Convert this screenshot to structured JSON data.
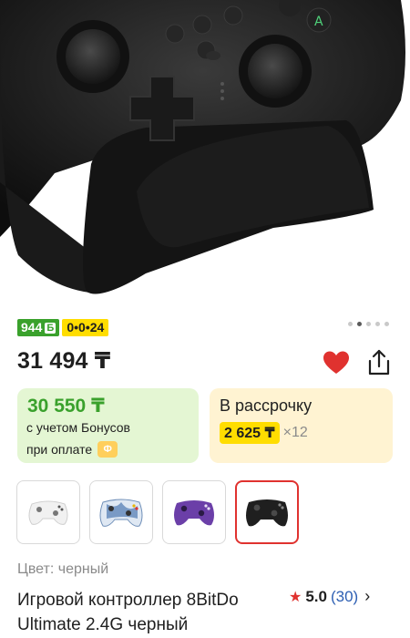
{
  "bonus_badge": {
    "value": "944",
    "icon_letter": "Б"
  },
  "installment_badge": {
    "text": "0•0•24"
  },
  "gallery": {
    "total": 5,
    "active_index": 2
  },
  "price": {
    "current": "31 494 ₸"
  },
  "actions": {
    "favorite_icon": "heart-icon",
    "share_icon": "share-icon",
    "favorite_color": "#e0322f"
  },
  "bonus_card": {
    "amount": "30 550 ₸",
    "line1": "с учетом Бонусов",
    "line2": "при оплате",
    "pay_icon_letter": "Ф"
  },
  "installment_card": {
    "title": "В рассрочку",
    "monthly": "2 625 ₸",
    "times": "×12"
  },
  "variants": [
    {
      "name": "white",
      "selected": false
    },
    {
      "name": "blue-white",
      "selected": false
    },
    {
      "name": "purple",
      "selected": false
    },
    {
      "name": "black",
      "selected": true
    }
  ],
  "color_label": "Цвет: черный",
  "product_title": "Игровой контроллер 8BitDo Ultimate 2.4G черный",
  "rating": {
    "score": "5.0",
    "count": "(30)"
  },
  "colors": {
    "accent_red": "#e0322f",
    "bonus_green": "#3aa12c",
    "kaspi_yellow": "#ffdd00"
  }
}
